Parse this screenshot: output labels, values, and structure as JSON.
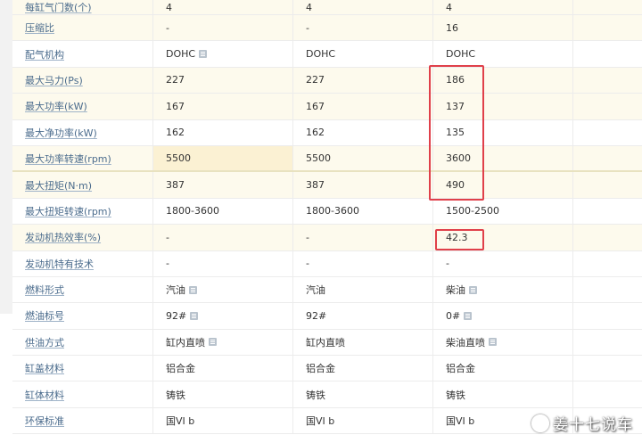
{
  "rows": [
    {
      "label": "每缸气门数(个)",
      "v1": "4",
      "v2": "4",
      "v3": "4",
      "shaded": true
    },
    {
      "label": "压缩比",
      "v1": "-",
      "v2": "-",
      "v3": "16",
      "shaded": true
    },
    {
      "label": "配气机构",
      "v1": "DOHC",
      "v1_icon": true,
      "v2": "DOHC",
      "v3": "DOHC",
      "shaded": false
    },
    {
      "label": "最大马力(Ps)",
      "v1": "227",
      "v2": "227",
      "v3": "186",
      "shaded": true
    },
    {
      "label": "最大功率(kW)",
      "v1": "167",
      "v2": "167",
      "v3": "137",
      "shaded": true
    },
    {
      "label": "最大净功率(kW)",
      "v1": "162",
      "v2": "162",
      "v3": "135",
      "shaded": false
    },
    {
      "label": "最大功率转速(rpm)",
      "v1": "5500",
      "v2": "5500",
      "v3": "3600",
      "shaded": true,
      "v1_highlight": true
    },
    {
      "label": "最大扭矩(N·m)",
      "v1": "387",
      "v2": "387",
      "v3": "490",
      "shaded": true
    },
    {
      "label": "最大扭矩转速(rpm)",
      "v1": "1800-3600",
      "v2": "1800-3600",
      "v3": "1500-2500",
      "shaded": false
    },
    {
      "label": "发动机热效率(%)",
      "v1": "-",
      "v2": "-",
      "v3": "42.3",
      "shaded": true
    },
    {
      "label": "发动机特有技术",
      "v1": "-",
      "v2": "-",
      "v3": "-",
      "shaded": false
    },
    {
      "label": "燃料形式",
      "v1": "汽油",
      "v1_icon": true,
      "v2": "汽油",
      "v3": "柴油",
      "v3_icon": true,
      "shaded": false
    },
    {
      "label": "燃油标号",
      "v1": "92#",
      "v1_icon": true,
      "v2": "92#",
      "v3": "0#",
      "v3_icon": true,
      "shaded": false
    },
    {
      "label": "供油方式",
      "v1": "缸内直喷",
      "v1_icon": true,
      "v2": "缸内直喷",
      "v3": "柴油直喷",
      "v3_icon": true,
      "shaded": false
    },
    {
      "label": "缸盖材料",
      "v1": "铝合金",
      "v2": "铝合金",
      "v3": "铝合金",
      "shaded": false
    },
    {
      "label": "缸体材料",
      "v1": "铸铁",
      "v2": "铸铁",
      "v3": "铸铁",
      "shaded": false
    },
    {
      "label": "环保标准",
      "v1": "国VI b",
      "v2": "国VI b",
      "v3": "国VI b",
      "shaded": false
    }
  ],
  "watermark": "姜十七说车",
  "colors": {
    "highlight_box": "#e0404a",
    "row_shade": "#fdfaed",
    "label": "#4a6b8c"
  }
}
